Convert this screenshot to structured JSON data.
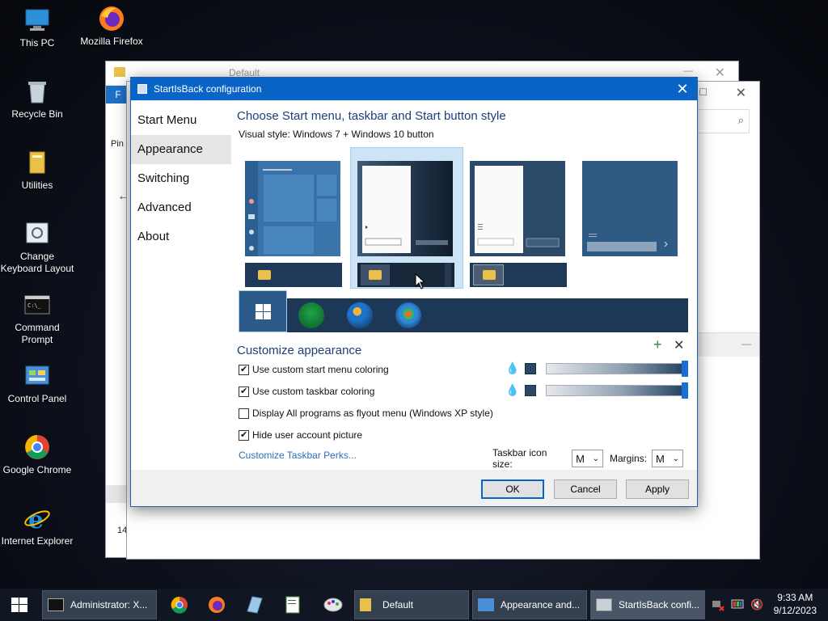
{
  "desktop": {
    "icons": [
      {
        "label": "This PC"
      },
      {
        "label": "Mozilla Firefox"
      },
      {
        "label": "Recycle Bin"
      },
      {
        "label": "Utilities"
      },
      {
        "label": "Change Keyboard Layout"
      },
      {
        "label": "Command Prompt"
      },
      {
        "label": "Control Panel"
      },
      {
        "label": "Google Chrome"
      },
      {
        "label": "Internet Explorer"
      }
    ]
  },
  "bg_window": {
    "title": "Default",
    "ribbon_tab": "F",
    "pin_label": "Pin",
    "status_fragment": "14"
  },
  "dialog": {
    "title": "StartIsBack configuration",
    "nav": [
      "Start Menu",
      "Appearance",
      "Switching",
      "Advanced",
      "About"
    ],
    "active_nav": "Appearance",
    "heading": "Choose Start menu, taskbar and Start button style",
    "visual_style": "Visual style:  Windows 7 + Windows 10 button",
    "customize_heading": "Customize appearance",
    "checkboxes": [
      {
        "label": "Use custom start menu coloring",
        "checked": true
      },
      {
        "label": "Use custom taskbar coloring",
        "checked": true
      },
      {
        "label": "Display All programs as flyout menu (Windows XP style)",
        "checked": false
      },
      {
        "label": "Hide user account picture",
        "checked": true
      }
    ],
    "sliders": [
      {
        "level": 1.0,
        "swatch": "#2b4766"
      },
      {
        "level": 1.0,
        "swatch": "#2b4766"
      }
    ],
    "link": "Customize Taskbar Perks...",
    "icon_size_label": "Taskbar icon size:",
    "icon_size_value": "M",
    "margins_label": "Margins:",
    "margins_value": "M",
    "buttons": {
      "ok": "OK",
      "cancel": "Cancel",
      "apply": "Apply"
    }
  },
  "taskbar": {
    "buttons": [
      {
        "label": "Administrator: X..."
      },
      {
        "label": "Default"
      },
      {
        "label": "Appearance and..."
      },
      {
        "label": "StartIsBack confi..."
      }
    ],
    "time": "9:33 AM",
    "date": "9/12/2023"
  },
  "colors": {
    "accent": "#0a64c8",
    "heading": "#1e3e78",
    "link": "#2a6fb8"
  }
}
